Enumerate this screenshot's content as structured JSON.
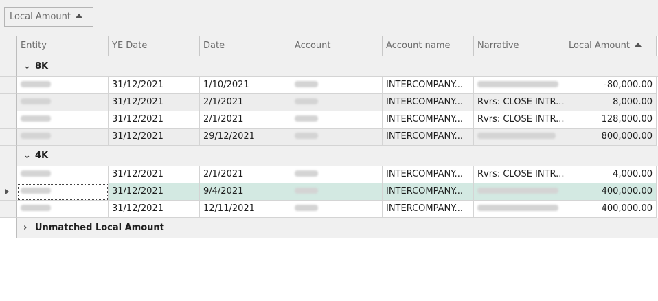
{
  "group_panel": {
    "chip_label": "Local Amount"
  },
  "columns": [
    "Entity",
    "YE Date",
    "Date",
    "Account",
    "Account name",
    "Narrative",
    "Local Amount"
  ],
  "groups": [
    {
      "label": "8K",
      "rows": [
        {
          "ye_date": "31/12/2021",
          "date": "1/10/2021",
          "account_name": "INTERCOMPANY...",
          "narrative": "",
          "local_amount": "-80,000.00"
        },
        {
          "ye_date": "31/12/2021",
          "date": "2/1/2021",
          "account_name": "INTERCOMPANY...",
          "narrative": "Rvrs: CLOSE INTR...",
          "local_amount": "8,000.00"
        },
        {
          "ye_date": "31/12/2021",
          "date": "2/1/2021",
          "account_name": "INTERCOMPANY...",
          "narrative": "Rvrs: CLOSE INTR...",
          "local_amount": "128,000.00"
        },
        {
          "ye_date": "31/12/2021",
          "date": "29/12/2021",
          "account_name": "INTERCOMPANY...",
          "narrative": "",
          "local_amount": "800,000.00"
        }
      ]
    },
    {
      "label": "4K",
      "rows": [
        {
          "ye_date": "31/12/2021",
          "date": "2/1/2021",
          "account_name": "INTERCOMPANY...",
          "narrative": "Rvrs: CLOSE INTR...",
          "local_amount": "4,000.00"
        },
        {
          "ye_date": "31/12/2021",
          "date": "9/4/2021",
          "account_name": "INTERCOMPANY...",
          "narrative": "",
          "local_amount": "400,000.00"
        },
        {
          "ye_date": "31/12/2021",
          "date": "12/11/2021",
          "account_name": "INTERCOMPANY...",
          "narrative": "",
          "local_amount": "400,000.00"
        }
      ]
    },
    {
      "label": "Unmatched Local Amount",
      "rows": []
    }
  ],
  "colors": {
    "selected_row": "#d3e9e2",
    "header_bg": "#f0f0f0",
    "alt_row": "#ededed"
  }
}
